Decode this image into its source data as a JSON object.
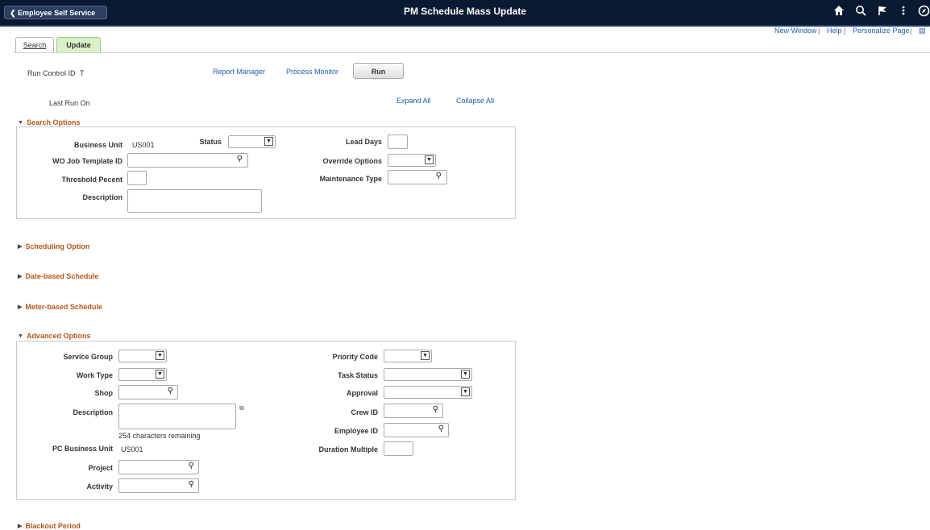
{
  "header": {
    "back_label": "Employee Self Service",
    "title": "PM Schedule Mass Update",
    "icons": [
      "home-icon",
      "search-icon",
      "flag-icon",
      "more-icon",
      "navbar-icon"
    ]
  },
  "utility_links": {
    "new_window": "New Window",
    "help": "Help",
    "personalize": "Personalize Page",
    "sep": "|"
  },
  "tabs": [
    {
      "label": "Search",
      "active": false
    },
    {
      "label": "Update",
      "active": true
    }
  ],
  "run_control": {
    "label": "Run Control ID",
    "value": "T",
    "report_manager": "Report Manager",
    "process_monitor": "Process Monitor",
    "run_label": "Run",
    "last_run_label": "Last Run On",
    "expand_all": "Expand All",
    "collapse_all": "Collapse All"
  },
  "search_options": {
    "title": "Search Options",
    "business_unit_label": "Business Unit",
    "business_unit_value": "US001",
    "status_label": "Status",
    "lead_days_label": "Lead Days",
    "wo_job_template_label": "WO Job Template ID",
    "override_options_label": "Override Options",
    "threshold_label": "Threshold Pecent",
    "maintenance_type_label": "Maintenance Type",
    "description_label": "Description"
  },
  "collapsed_sections": {
    "scheduling": "Scheduling Option",
    "date_based": "Date-based Schedule",
    "meter_based": "Meter-based Schedule",
    "blackout": "Blackout Period"
  },
  "advanced_options": {
    "title": "Advanced Options",
    "service_group_label": "Service Group",
    "priority_code_label": "Priority Code",
    "work_type_label": "Work Type",
    "task_status_label": "Task Status",
    "shop_label": "Shop",
    "approval_label": "Approval",
    "description_label": "Description",
    "crew_id_label": "Crew ID",
    "chars_remaining": "254 characters remaining",
    "employee_id_label": "Employee ID",
    "pc_business_unit_label": "PC Business Unit",
    "pc_business_unit_value": "US001",
    "duration_multiple_label": "Duration Multiple",
    "project_label": "Project",
    "activity_label": "Activity"
  },
  "colors": {
    "banner": "#0b1a33",
    "section_header": "#b7561b",
    "link": "#1f5cb2",
    "active_tab": "#d9f0c8"
  }
}
